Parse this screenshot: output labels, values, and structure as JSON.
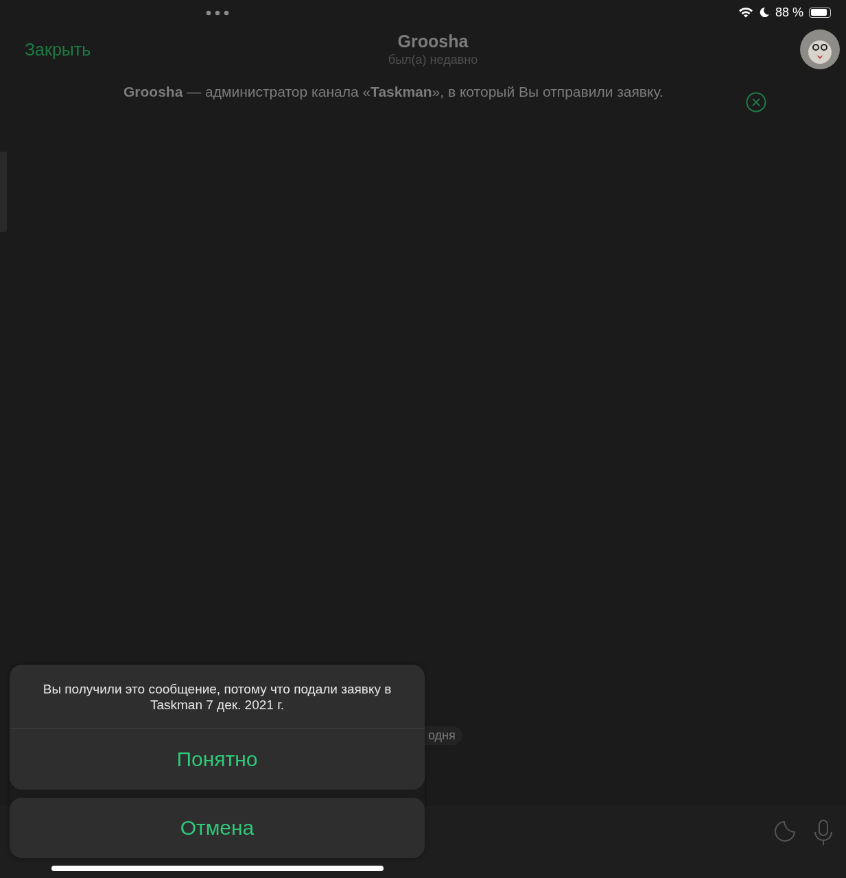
{
  "status_bar": {
    "battery_percent": "88 %"
  },
  "header": {
    "close": "Закрыть",
    "title": "Groosha",
    "subtitle": "был(а) недавно"
  },
  "banner": {
    "text": "**Groosha** — администратор канала «**Taskman**», в который Вы отправили заявку."
  },
  "date_chip": "одня",
  "action_sheet": {
    "message": "Вы получили это сообщение, потому что подали заявку в Taskman 7 дек. 2021 г.",
    "actions": [
      "Понятно"
    ],
    "cancel": "Отмена"
  }
}
